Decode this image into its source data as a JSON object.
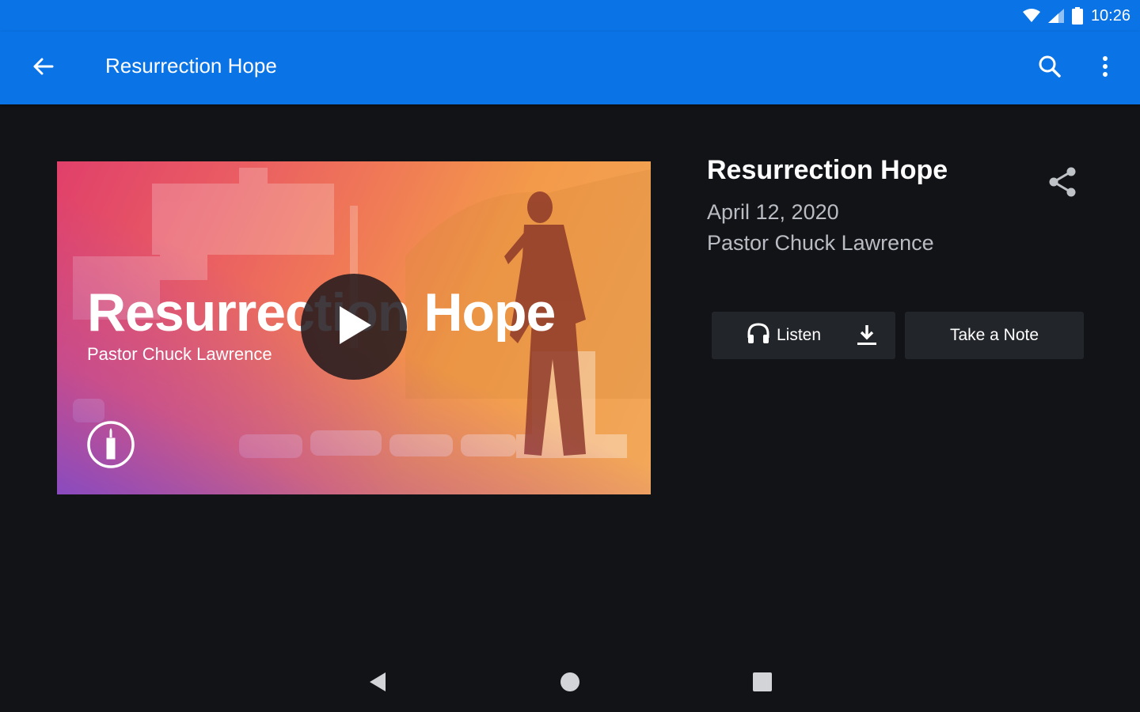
{
  "status_bar": {
    "time": "10:26",
    "icons": [
      "wifi-icon",
      "cell-signal-icon",
      "battery-icon"
    ]
  },
  "app_bar": {
    "title": "Resurrection Hope",
    "icons": [
      "back-arrow-icon",
      "search-icon",
      "more-vert-icon"
    ],
    "color": "#0a73e6"
  },
  "video": {
    "overlay_title": "Resurrection Hope",
    "overlay_subtitle": "Pastor Chuck Lawrence",
    "play_icon": "play-icon"
  },
  "sermon": {
    "title": "Resurrection Hope",
    "date": "April 12, 2020",
    "speaker": "Pastor Chuck Lawrence",
    "share_icon": "share-icon"
  },
  "actions": {
    "listen_label": "Listen",
    "take_note_label": "Take a Note",
    "icons": [
      "headphones-icon",
      "download-icon"
    ]
  },
  "nav_bar": {
    "icons": [
      "nav-back-icon",
      "nav-home-icon",
      "nav-recents-icon"
    ]
  }
}
